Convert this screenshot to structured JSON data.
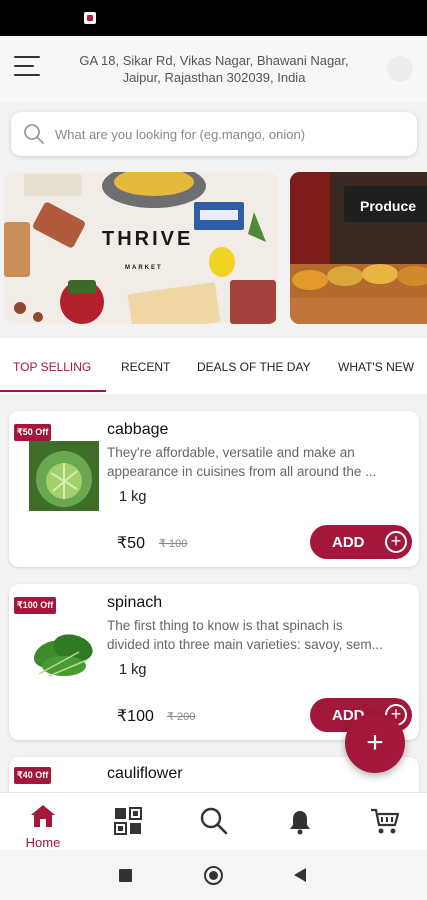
{
  "header": {
    "address_line1": "GA 18, Sikar Rd, Vikas Nagar, Bhawani Nagar,",
    "address_line2": "Jaipur, Rajasthan 302039, India",
    "menu_icon": "hamburger-menu-icon",
    "profile_icon": "profile-icon"
  },
  "search": {
    "placeholder": "What are you looking for (eg.mango, onion)",
    "value": ""
  },
  "banners": [
    {
      "brand": "THRIVE",
      "subtitle": "MARKET"
    },
    {
      "sign": "Produce"
    }
  ],
  "tabs": [
    {
      "label": "TOP SELLING",
      "active": true
    },
    {
      "label": "RECENT",
      "active": false
    },
    {
      "label": "DEALS OF THE DAY",
      "active": false
    },
    {
      "label": "WHAT'S NEW",
      "active": false
    }
  ],
  "products": [
    {
      "badge": "₹50 Off",
      "name": "cabbage",
      "desc_line1": "They're affordable, versatile and make an",
      "desc_line2": "appearance in cuisines from all around the ...",
      "qty": "1 kg",
      "price": "₹50",
      "old_price": "₹ 100",
      "add_label": "ADD"
    },
    {
      "badge": "₹100 Off",
      "name": "spinach",
      "desc_line1": "The first thing to know is that spinach is",
      "desc_line2": "divided into three main varieties: savoy, sem...",
      "qty": "1 kg",
      "price": "₹100",
      "old_price": "₹ 200",
      "add_label": "ADD"
    },
    {
      "badge": "₹40 Off",
      "name": "cauliflower"
    }
  ],
  "fab": {
    "label": "+"
  },
  "bottom_nav": {
    "home_label": "Home",
    "icons": [
      "home-icon",
      "categories-grid-icon",
      "search-icon",
      "bell-icon",
      "cart-icon"
    ]
  },
  "colors": {
    "accent": "#a3173a",
    "background": "#f2f2f2"
  }
}
